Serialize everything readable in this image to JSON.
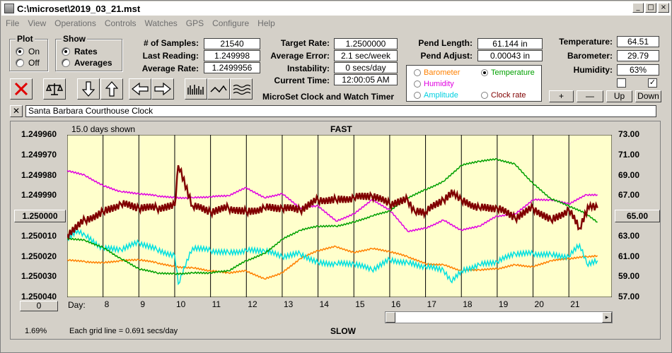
{
  "window": {
    "title": "C:\\microset\\2019_03_21.mst"
  },
  "menu": [
    "File",
    "View",
    "Operations",
    "Controls",
    "Watches",
    "GPS",
    "Configure",
    "Help"
  ],
  "plot_group": {
    "label": "Plot",
    "on": "On",
    "off": "Off"
  },
  "show_group": {
    "label": "Show",
    "rates": "Rates",
    "averages": "Averages"
  },
  "stats": {
    "samples_label": "# of Samples:",
    "samples": "21540",
    "last_label": "Last Reading:",
    "last": "1.249998",
    "avg_label": "Average Rate:",
    "avg": "1.2499956"
  },
  "targets": {
    "target_label": "Target Rate:",
    "target": "1.2500000",
    "error_label": "Average Error:",
    "error": "2.1 sec/week",
    "instab_label": "Instability:",
    "instab": "0 secs/day",
    "time_label": "Current Time:",
    "time": "12:00:05 AM",
    "app_name": "MicroSet Clock and Watch Timer"
  },
  "pend": {
    "length_label": "Pend Length:",
    "length": "61.144 in",
    "adjust_label": "Pend Adjust:",
    "adjust": "0.00043 in"
  },
  "legend": {
    "barometer": "Barometer",
    "temperature": "Temperature",
    "humidity": "Humidity",
    "amplitude": "Amplitude",
    "clockrate": "Clock rate",
    "colors": {
      "barometer": "#ff8000",
      "temperature": "#00a000",
      "humidity": "#e000e0",
      "amplitude": "#00e0e0",
      "clockrate": "#800000"
    }
  },
  "env": {
    "temp_label": "Temperature:",
    "temp": "64.51",
    "baro_label": "Barometer:",
    "baro": "29.79",
    "hum_label": "Humidity:",
    "hum": "63%",
    "btn_plus": "+",
    "btn_minus": "—",
    "btn_up": "Up",
    "btn_down": "Down"
  },
  "clock_name": "Santa Barbara Courthouse Clock",
  "plot": {
    "days_shown": "15.0 days shown",
    "fast": "FAST",
    "slow": "SLOW",
    "grid_note": "Each grid line = 0.691 secs/day",
    "day_label": "Day:",
    "left_ticks": [
      "1.249960",
      "1.249970",
      "1.249980",
      "1.249990",
      "1.250000",
      "1.250010",
      "1.250020",
      "1.250030",
      "1.250040"
    ],
    "right_ticks": [
      "73.00",
      "71.00",
      "69.00",
      "67.00",
      "65.00",
      "63.00",
      "61.00",
      "59.00",
      "57.00"
    ],
    "zero_button": "0",
    "percent": "1.69%"
  },
  "chart_data": {
    "type": "line",
    "x_days": [
      "8",
      "9",
      "10",
      "11",
      "12",
      "13",
      "14",
      "15",
      "16",
      "17",
      "18",
      "19",
      "20",
      "21"
    ],
    "x_range": [
      7,
      22.2
    ],
    "left_axis": {
      "ylim": [
        1.25004,
        1.24996
      ],
      "inverted": true
    },
    "right_axis": {
      "ylim": [
        57,
        73
      ]
    },
    "series": [
      {
        "name": "Clock rate",
        "axis": "left",
        "color": "#800000",
        "x": [
          7,
          7.5,
          8,
          8.5,
          9,
          9.5,
          10,
          10.1,
          10.5,
          11,
          11.5,
          12,
          12.5,
          13,
          13.5,
          14,
          14.5,
          15,
          15.5,
          16,
          16.5,
          16.7,
          17,
          17.5,
          17.8,
          18,
          18.5,
          19,
          19.5,
          20,
          20.5,
          21,
          21.3,
          21.6,
          21.8
        ],
        "y": [
          1.250009,
          1.250002,
          1.249998,
          1.249994,
          1.249996,
          1.249996,
          1.249995,
          1.249975,
          1.249995,
          1.249998,
          1.249996,
          1.249998,
          1.249996,
          1.249996,
          1.249997,
          1.249992,
          1.249992,
          1.249991,
          1.24999,
          1.249994,
          1.249992,
          1.249998,
          1.249998,
          1.249992,
          1.249988,
          1.249992,
          1.249996,
          1.249996,
          1.250001,
          1.249996,
          1.250002,
          1.249997,
          1.250006,
          1.249994,
          1.249996
        ]
      },
      {
        "name": "Humidity",
        "axis": "right",
        "color": "#e000e0",
        "x": [
          7,
          7.5,
          8,
          8.5,
          9,
          9.5,
          10,
          10.5,
          11,
          11.5,
          12,
          12.5,
          13,
          13.5,
          14,
          14.5,
          15,
          15.5,
          16,
          16.5,
          17,
          17.5,
          18,
          18.5,
          19,
          19.5,
          20,
          20.5,
          21,
          21.5,
          21.8
        ],
        "y": [
          69.5,
          69,
          68,
          67.4,
          67.2,
          67,
          66.8,
          66.8,
          66.9,
          67,
          67.8,
          66.8,
          67.2,
          65.8,
          66,
          64.5,
          65.2,
          66.6,
          65.6,
          63.5,
          63.8,
          64.6,
          63.6,
          64,
          65,
          65.2,
          66.6,
          66.6,
          66.2,
          67.1,
          67.1
        ]
      },
      {
        "name": "Temperature",
        "axis": "right",
        "color": "#00a000",
        "x": [
          7,
          7.5,
          8,
          8.5,
          9,
          9.5,
          10,
          10.5,
          11,
          11.5,
          12,
          12.5,
          13,
          13.5,
          14,
          14.5,
          15,
          15.5,
          16,
          16.5,
          17,
          17.5,
          18,
          18.5,
          19,
          19.5,
          20,
          20.5,
          21,
          21.5,
          21.8
        ],
        "y": [
          62.8,
          62.6,
          61.9,
          60.8,
          59.8,
          59.4,
          59.3,
          59.4,
          59.4,
          59.6,
          60.6,
          61.3,
          62.7,
          63.6,
          64,
          64,
          64.4,
          65,
          65.5,
          66.8,
          67.6,
          68.4,
          70,
          70.4,
          70.6,
          70.1,
          68.2,
          66.7,
          66,
          65.2,
          64.4
        ]
      },
      {
        "name": "Barometer",
        "axis": "right",
        "color": "#ff8000",
        "x": [
          7,
          7.5,
          8,
          8.5,
          9,
          9.5,
          10,
          10.5,
          11,
          11.5,
          12,
          12.5,
          13,
          13.5,
          14,
          14.5,
          15,
          15.5,
          16,
          16.5,
          17,
          17.5,
          18,
          18.5,
          19,
          19.5,
          20,
          20.5,
          21,
          21.5,
          21.8
        ],
        "y": [
          60.7,
          60.5,
          60.4,
          60.6,
          60.7,
          60.4,
          60,
          59.9,
          59.6,
          59.4,
          59.6,
          58.8,
          59.4,
          60.8,
          61.6,
          62,
          61.4,
          61.8,
          61.5,
          61,
          60.3,
          60.2,
          59.6,
          59.7,
          59.8,
          60.2,
          60,
          60.6,
          60.8,
          61,
          61.1
        ]
      },
      {
        "name": "Amplitude",
        "axis": "right",
        "color": "#00e0e0",
        "x": [
          7,
          7.3,
          7.5,
          8,
          8.5,
          9,
          9.5,
          10,
          10.1,
          10.5,
          11,
          11.5,
          12,
          12.5,
          13,
          13.5,
          14,
          14.5,
          15,
          15.5,
          16,
          16.5,
          17,
          17.5,
          17.7,
          18,
          18.5,
          19,
          19.5,
          20,
          20.5,
          21,
          21.3,
          21.5,
          21.8
        ],
        "y": [
          62.8,
          63.6,
          63.1,
          61.8,
          61.7,
          62.4,
          61.7,
          61.1,
          58.3,
          61.9,
          61.6,
          61.4,
          61.6,
          61.6,
          61,
          61.3,
          60.4,
          60.3,
          60.3,
          59.7,
          60.7,
          60.4,
          60,
          59.7,
          58.6,
          59.6,
          60.2,
          60.5,
          61.3,
          61.3,
          61.2,
          61,
          62.2,
          60.3,
          60.6
        ]
      }
    ]
  }
}
